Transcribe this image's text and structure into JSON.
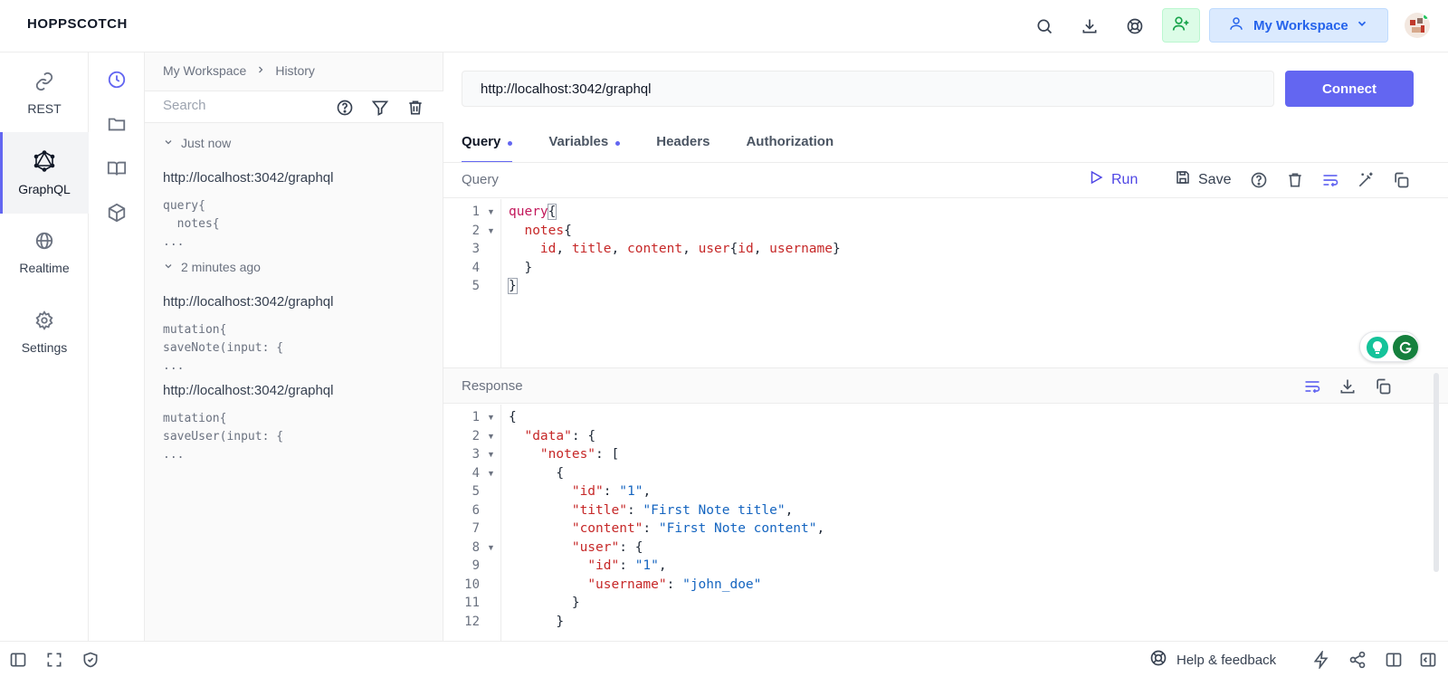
{
  "header": {
    "brand": "HOPPSCOTCH",
    "workspace_label": "My Workspace",
    "icons": [
      "search-icon",
      "download-icon",
      "support-icon",
      "invite-user-icon",
      "user-icon",
      "chevron-down-icon"
    ]
  },
  "rail": {
    "items": [
      {
        "label": "REST",
        "icon": "link-icon"
      },
      {
        "label": "GraphQL",
        "icon": "graphql-icon",
        "active": true
      },
      {
        "label": "Realtime",
        "icon": "globe-icon"
      },
      {
        "label": "Settings",
        "icon": "gear-icon"
      }
    ]
  },
  "rail2": {
    "icons": [
      "history-icon",
      "folder-icon",
      "book-icon",
      "cube-icon"
    ]
  },
  "history": {
    "breadcrumb": [
      "My Workspace",
      "History"
    ],
    "search_placeholder": "Search",
    "groups": [
      {
        "label": "Just now"
      },
      {
        "label": "2 minutes ago"
      }
    ],
    "entries": [
      {
        "url": "http://localhost:3042/graphql",
        "preview": "query{\n  notes{\n..."
      },
      {
        "url": "http://localhost:3042/graphql",
        "preview": "mutation{\nsaveNote(input: {\n..."
      },
      {
        "url": "http://localhost:3042/graphql",
        "preview": "mutation{\nsaveUser(input: {\n..."
      }
    ]
  },
  "main": {
    "url": "http://localhost:3042/graphql",
    "connect_label": "Connect",
    "tabs": [
      {
        "label": "Query",
        "dot": true,
        "active": true
      },
      {
        "label": "Variables",
        "dot": true
      },
      {
        "label": "Headers"
      },
      {
        "label": "Authorization"
      }
    ],
    "query_title": "Query",
    "run_label": "Run",
    "save_label": "Save",
    "response_title": "Response"
  },
  "footer": {
    "help_label": "Help & feedback"
  },
  "colors": {
    "accent": "#6366f1",
    "invite_bg": "#dcfce7",
    "workspace_bg": "#dbeafe"
  }
}
